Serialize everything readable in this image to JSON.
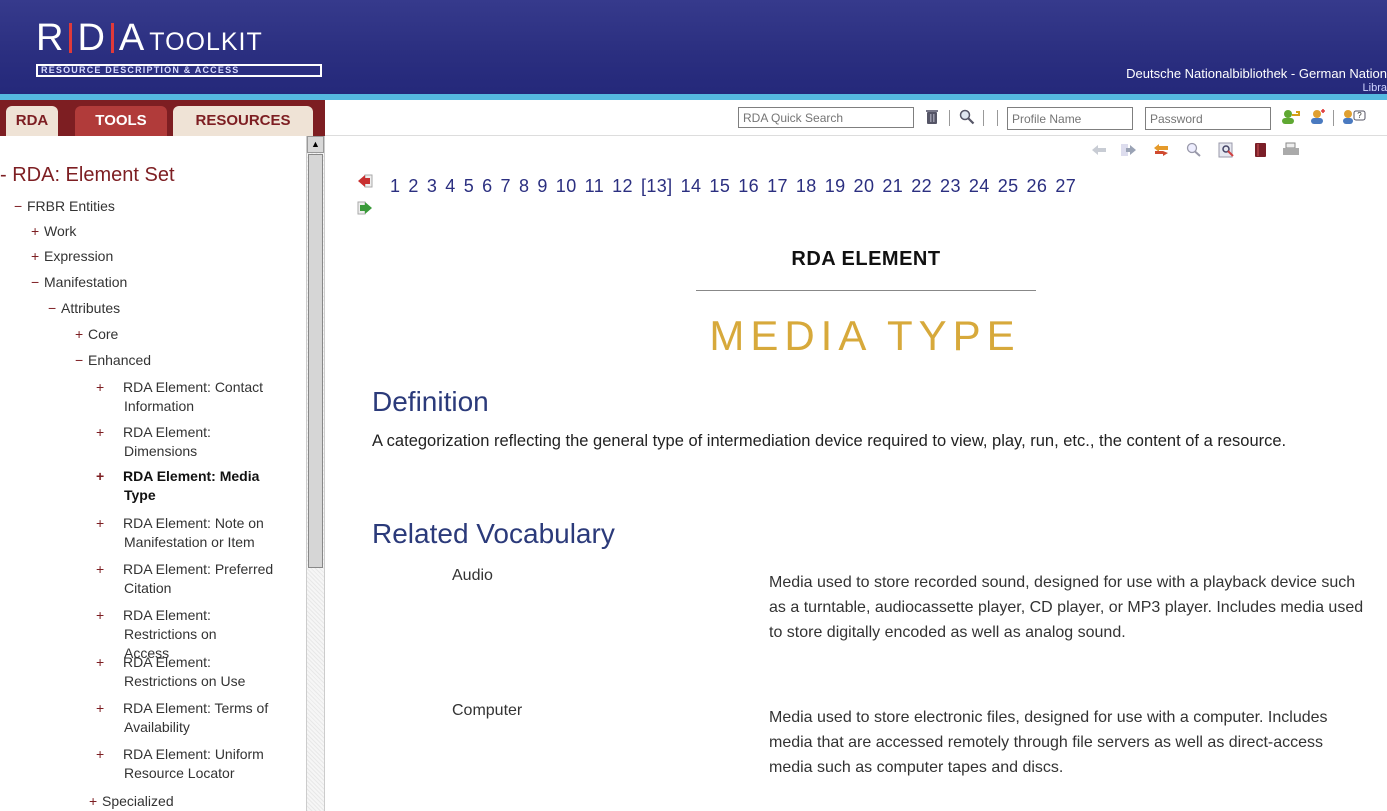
{
  "header": {
    "logo_main": "R D A",
    "logo_toolkit": "TOOLKIT",
    "logo_sub": "RESOURCE DESCRIPTION & ACCESS",
    "org_name": "Deutsche Nationalbibliothek - German Nation",
    "org_name_overflow": "Libra",
    "accent": "#2b2f80",
    "strip_color": "#55b9e0"
  },
  "tabs": [
    {
      "label": "RDA",
      "active": false
    },
    {
      "label": "TOOLS",
      "active": true
    },
    {
      "label": "RESOURCES",
      "active": false
    }
  ],
  "toolbar": {
    "quick_search_placeholder": "RDA Quick Search",
    "profile_placeholder": "Profile Name",
    "password_placeholder": "Password",
    "icons": [
      "clear-icon",
      "search-icon",
      "login-icon",
      "new-user-icon",
      "help-icon"
    ]
  },
  "sidebar": {
    "title": "RDA: Element Set",
    "items": [
      {
        "mk": "−",
        "text": "FRBR Entities"
      },
      {
        "mk": "+",
        "text": "Work"
      },
      {
        "mk": "+",
        "text": "Expression"
      },
      {
        "mk": "−",
        "text": "Manifestation"
      },
      {
        "mk": "−",
        "text": "Attributes"
      },
      {
        "mk": "+",
        "text": "Core"
      },
      {
        "mk": "−",
        "text": "Enhanced"
      },
      {
        "mk": "+",
        "text": "RDA Element: Contact Information"
      },
      {
        "mk": "+",
        "text": "RDA Element: Dimensions"
      },
      {
        "mk": "+",
        "text": "RDA Element: Media Type"
      },
      {
        "mk": "+",
        "text": "RDA Element: Note on Manifestation or Item"
      },
      {
        "mk": "+",
        "text": "RDA Element: Preferred Citation"
      },
      {
        "mk": "+",
        "text": "RDA Element: Restrictions on Access"
      },
      {
        "mk": "+",
        "text": "RDA Element: Restrictions on Use"
      },
      {
        "mk": "+",
        "text": "RDA Element: Terms of Availability"
      },
      {
        "mk": "+",
        "text": "RDA Element: Uniform Resource Locator"
      },
      {
        "mk": "+",
        "text": "Specialized"
      }
    ]
  },
  "pager": {
    "pages": [
      "1",
      "2",
      "3",
      "4",
      "5",
      "6",
      "7",
      "8",
      "9",
      "10",
      "11",
      "12",
      "[13]",
      "14",
      "15",
      "16",
      "17",
      "18",
      "19",
      "20",
      "21",
      "22",
      "23",
      "24",
      "25",
      "26",
      "27"
    ],
    "current": "[13]"
  },
  "content": {
    "element_label": "RDA ELEMENT",
    "element_title": "MEDIA TYPE",
    "title_color": "#d7a93b",
    "definition_heading": "Definition",
    "definition_text": "A categorization reflecting the general type of intermediation device required to view, play, run, etc., the content of a resource.",
    "vocab_heading": "Related Vocabulary",
    "vocab": [
      {
        "term": "Audio",
        "desc": "Media used to store recorded sound, designed for use with a playback device such as a turntable, audiocassette player, CD player, or MP3 player. Includes media used to store digitally encoded as well as analog sound."
      },
      {
        "term": "Computer",
        "desc": "Media used to store electronic files, designed for use with a computer. Includes media that are accessed remotely through file servers as well as direct-access media such as computer tapes and discs."
      }
    ]
  }
}
